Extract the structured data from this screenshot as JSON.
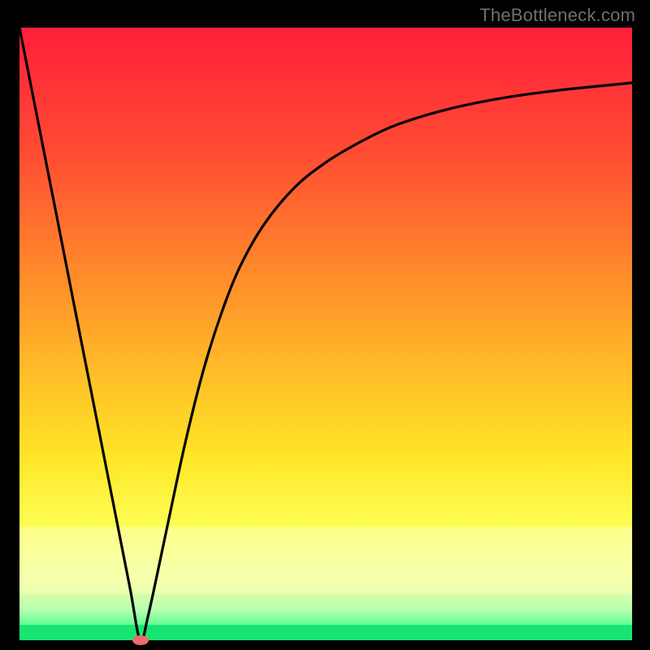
{
  "watermark": "TheBottleneck.com",
  "chart_data": {
    "type": "line",
    "title": "",
    "xlabel": "",
    "ylabel": "",
    "xlim": [
      0,
      1
    ],
    "ylim": [
      0,
      1
    ],
    "series": [
      {
        "name": "bottleneck-curve",
        "x": [
          0.0,
          0.03,
          0.06,
          0.09,
          0.12,
          0.15,
          0.18,
          0.197,
          0.21,
          0.24,
          0.27,
          0.3,
          0.33,
          0.36,
          0.4,
          0.45,
          0.5,
          0.55,
          0.6,
          0.65,
          0.7,
          0.75,
          0.8,
          0.85,
          0.9,
          0.95,
          1.0
        ],
        "y": [
          1.0,
          0.848,
          0.696,
          0.543,
          0.391,
          0.239,
          0.087,
          0.0,
          0.04,
          0.18,
          0.32,
          0.44,
          0.535,
          0.61,
          0.68,
          0.74,
          0.78,
          0.81,
          0.835,
          0.853,
          0.867,
          0.878,
          0.887,
          0.894,
          0.9,
          0.905,
          0.91
        ]
      }
    ],
    "markers": [
      {
        "name": "optimal-point",
        "x": 0.197,
        "y": 0.0
      }
    ],
    "gradient_stops": [
      {
        "offset": 0.0,
        "color": "#ff1f3a"
      },
      {
        "offset": 0.2,
        "color": "#ff4b33"
      },
      {
        "offset": 0.4,
        "color": "#ff8a2b"
      },
      {
        "offset": 0.55,
        "color": "#ffb928"
      },
      {
        "offset": 0.7,
        "color": "#ffe528"
      },
      {
        "offset": 0.82,
        "color": "#fdff55"
      },
      {
        "offset": 0.9,
        "color": "#edffa0"
      },
      {
        "offset": 0.95,
        "color": "#b8ffb0"
      },
      {
        "offset": 0.985,
        "color": "#3eff8a"
      },
      {
        "offset": 1.0,
        "color": "#13e86a"
      }
    ],
    "bands": [
      {
        "name": "pale-yellow-band",
        "y0": 0.185,
        "y1": 0.075,
        "color": "#fbffb8",
        "opacity": 0.55
      },
      {
        "name": "green-band",
        "y0": 0.025,
        "y1": 0.0,
        "color": "#19e371",
        "opacity": 1.0
      }
    ]
  }
}
